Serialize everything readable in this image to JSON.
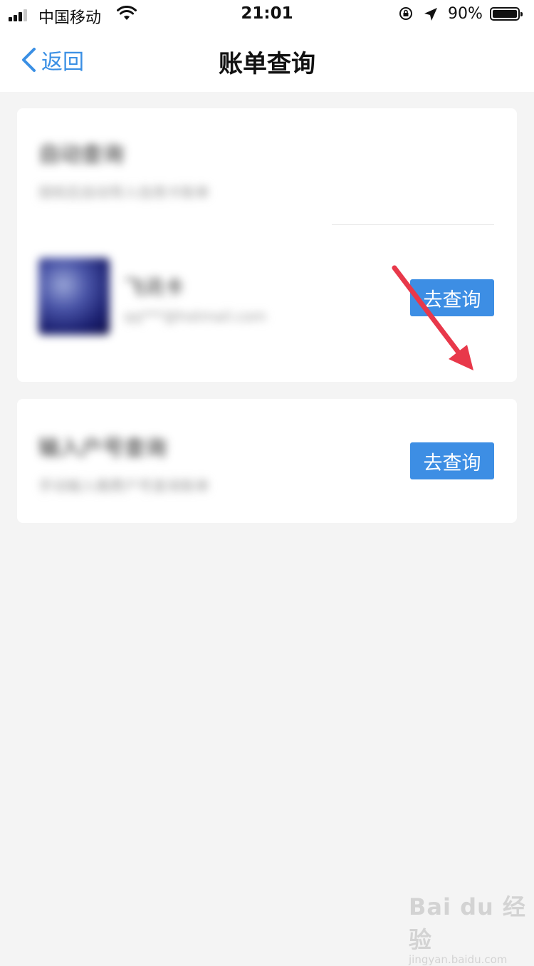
{
  "status_bar": {
    "carrier": "中国移动",
    "time": "21:01",
    "battery_percent": "90%"
  },
  "nav": {
    "back_label": "返回",
    "title": "账单查询"
  },
  "cards": [
    {
      "section_title": "自动查询",
      "section_desc": "授权后自动导入信用卡账单",
      "account_name": "飞讯卡",
      "account_email": "qq***@hotmail.com",
      "button_label": "去查询"
    },
    {
      "section_title": "输入户号查询",
      "section_desc": "手动输入缴费户号查询账单",
      "button_label": "去查询"
    }
  ],
  "watermark": {
    "logo": "Bai du 经验",
    "url": "jingyan.baidu.com"
  },
  "colors": {
    "accent": "#3d8ee4",
    "back_link": "#3a8fe4",
    "annotation_arrow": "#e8384a",
    "background": "#f4f4f4"
  }
}
